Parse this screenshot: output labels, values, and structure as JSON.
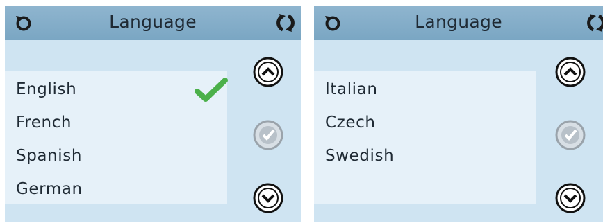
{
  "screens": [
    {
      "title": "Language",
      "items": [
        "English",
        "French",
        "Spanish",
        "German"
      ],
      "selected": "English"
    },
    {
      "title": "Language",
      "items": [
        "Italian",
        "Czech",
        "Swedish"
      ]
    }
  ],
  "icons": {
    "back": "back-icon",
    "refresh": "refresh-icon",
    "check": "checkmark-icon",
    "up": "arrow-up-icon",
    "confirm": "confirm-icon",
    "down": "arrow-down-icon"
  },
  "colors": {
    "header": "#7aa6c3",
    "background": "#cfe4f2",
    "list_background": "#e6f1f9",
    "check": "#4bb04a"
  }
}
